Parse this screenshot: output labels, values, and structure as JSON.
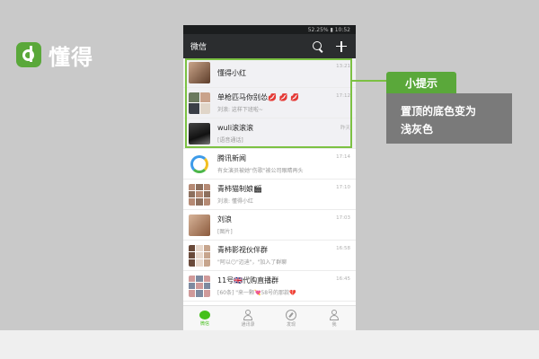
{
  "logo": {
    "text": "懂得"
  },
  "phone": {
    "status_text": "52.25%  ▮ 10:52",
    "title": "微信"
  },
  "chats": [
    {
      "name": "懂得小红",
      "preview": "",
      "time": "13:21"
    },
    {
      "name": "单枪匹马你别怂💋 💋 💋",
      "preview": "刘浪: 这样下班啦~",
      "time": "17:12"
    },
    {
      "name": "wuli滚滚滚",
      "preview": "[语音通话]",
      "time": "昨天"
    },
    {
      "name": "腾讯新闻",
      "preview": "有女演员被她\"伤歌\"被公司眼睛再头",
      "time": "17:14"
    },
    {
      "name": "青柿猫制娘🎬",
      "preview": "刘浪: 懂得小红",
      "time": "17:10"
    },
    {
      "name": "刘浪",
      "preview": "[图片]",
      "time": "17:03"
    },
    {
      "name": "青柿影视伙伴群",
      "preview": "\"阿以😶\"迈迪\"，\"加入了群聊",
      "time": "16:58"
    },
    {
      "name": "11号🇬🇧代购直播群",
      "preview": "[60条] \"来一颗💘58号的那款💔",
      "time": "16:45"
    }
  ],
  "tabs": [
    {
      "label": "微信"
    },
    {
      "label": "通讯录"
    },
    {
      "label": "发现"
    },
    {
      "label": "我"
    }
  ],
  "callout": {
    "title": "小提示",
    "line1": "置顶的底色变为",
    "line2": "浅灰色"
  },
  "colors": {
    "accent_green": "#5aa83a",
    "highlight_green": "#7cc143",
    "pinned_bg": "#f1f1f4",
    "wechat_green": "#45c01a"
  }
}
